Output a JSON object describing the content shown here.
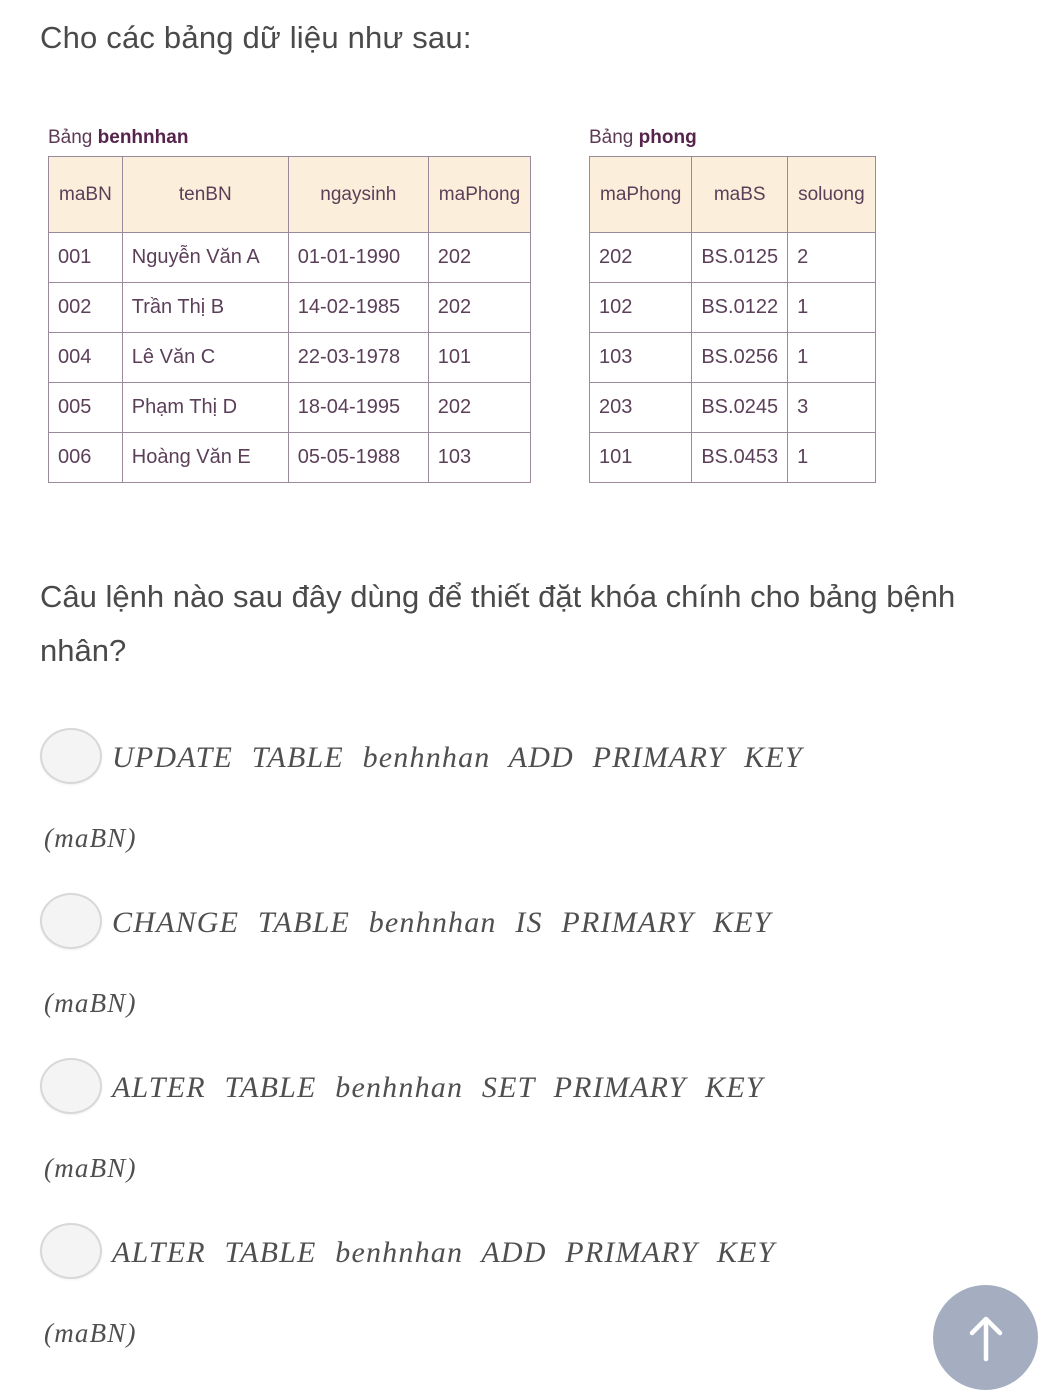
{
  "intro": "Cho các bảng dữ liệu như sau:",
  "tables": [
    {
      "caption_prefix": "Bảng",
      "caption_name": "benhnhan",
      "columns": [
        "maBN",
        "tenBN",
        "ngaysinh",
        "maPhong"
      ],
      "rows": [
        [
          "001",
          "Nguyễn Văn A",
          "01-01-1990",
          "202"
        ],
        [
          "002",
          "Trần Thị B",
          "14-02-1985",
          "202"
        ],
        [
          "004",
          "Lê Văn C",
          "22-03-1978",
          "101"
        ],
        [
          "005",
          "Phạm Thị D",
          "18-04-1995",
          "202"
        ],
        [
          "006",
          "Hoàng Văn E",
          "05-05-1988",
          "103"
        ]
      ]
    },
    {
      "caption_prefix": "Bảng",
      "caption_name": "phong",
      "columns": [
        "maPhong",
        "maBS",
        "soluong"
      ],
      "rows": [
        [
          "202",
          "BS.0125",
          "2"
        ],
        [
          "102",
          "BS.0122",
          "1"
        ],
        [
          "103",
          "BS.0256",
          "1"
        ],
        [
          "203",
          "BS.0245",
          "3"
        ],
        [
          "101",
          "BS.0453",
          "1"
        ]
      ]
    }
  ],
  "question": "Câu lệnh nào sau đây dùng để thiết đặt khóa chính cho bảng bệnh nhân?",
  "options": [
    {
      "main": "UPDATE TABLE benhnhan ADD PRIMARY KEY",
      "tail": "(maBN)",
      "selected": false
    },
    {
      "main": "CHANGE TABLE benhnhan IS PRIMARY KEY",
      "tail": "(maBN)",
      "selected": false
    },
    {
      "main": "ALTER TABLE benhnhan SET PRIMARY KEY",
      "tail": "(maBN)",
      "selected": false
    },
    {
      "main": "ALTER TABLE benhnhan ADD PRIMARY KEY",
      "tail": "(maBN)",
      "selected": false
    }
  ],
  "scroll_top_button": {
    "icon": "arrow-up-icon",
    "color": "#a5aec0"
  },
  "colors": {
    "table_header_bg": "#fbeedb",
    "table_border": "#9b8a9b",
    "table_text": "#5b3f59",
    "caption_text": "#55234b",
    "body_text": "#4a4a4a",
    "option_text": "#4f4f4f",
    "radio_fill": "#f4f4f4",
    "radio_border": "#d8d8d8"
  }
}
